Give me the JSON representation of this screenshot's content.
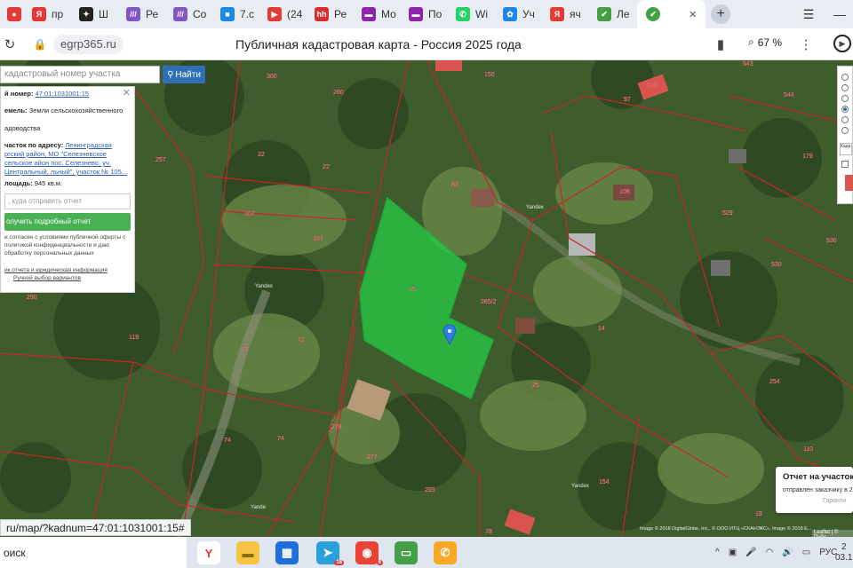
{
  "browser": {
    "tabs": [
      {
        "label": "(24",
        "color": "#e53935",
        "glyph": "●"
      },
      {
        "label": "пр",
        "color": "#e53935",
        "glyph": "Я"
      },
      {
        "label": "Ш",
        "color": "#222222",
        "glyph": "✦"
      },
      {
        "label": "Ре",
        "color": "#7e57c2",
        "glyph": "///"
      },
      {
        "label": "Со",
        "color": "#7e57c2",
        "glyph": "///"
      },
      {
        "label": "7.с",
        "color": "#1e88e5",
        "glyph": "■"
      },
      {
        "label": "(24",
        "color": "#e53935",
        "glyph": "▶"
      },
      {
        "label": "Ре",
        "color": "#d32f2f",
        "glyph": "hh"
      },
      {
        "label": "Мо",
        "color": "#8e24aa",
        "glyph": "▬"
      },
      {
        "label": "По",
        "color": "#8e24aa",
        "glyph": "▬"
      },
      {
        "label": "Wi",
        "color": "#25d366",
        "glyph": "✆"
      },
      {
        "label": "Уч",
        "color": "#1e88e5",
        "glyph": "✿"
      },
      {
        "label": "яч",
        "color": "#e53935",
        "glyph": "Я"
      },
      {
        "label": "Ле",
        "color": "#43a047",
        "glyph": "✔"
      }
    ],
    "active_tab": {
      "label": "",
      "color": "#43a047",
      "glyph": "✔",
      "close": "✕"
    },
    "new_tab": "+",
    "menu_icon": "☰",
    "minimize_icon": "—",
    "domain": "egrp365.ru",
    "page_title": "Публичная кадастровая карта - Россия 2025 года",
    "zoom": "67 %"
  },
  "map": {
    "search_placeholder": "кадастровый номер участка",
    "search_button": "Найти",
    "selected_parcel_label": "15",
    "parcel_numbers": [
      "260",
      "300",
      "150",
      "97",
      "539",
      "543",
      "544",
      "257",
      "22",
      "22",
      "107",
      "107",
      "83",
      "108",
      "529",
      "530",
      "530",
      "72",
      "72",
      "119",
      "74",
      "74",
      "276",
      "277",
      "295",
      "154",
      "78",
      "265/2",
      "14",
      "25",
      "254",
      "290",
      "15",
      "179",
      "110",
      "19"
    ],
    "right_panel": {
      "input_placeholder": "Када"
    },
    "info_panel": {
      "number_label": "й номер:",
      "number_value": "47:01:1031001:15",
      "category_label": "емель:",
      "category_value": "Земли сельскохозяйственного",
      "category_value2": "адоводства",
      "address_label": "часток по адресу:",
      "address_value": "Ленинградская ргский район, МО \"Селезневское сельское айон пос. Селезнево, уч. Центральный, льный\", участок № 105...",
      "area_label": "лощадь:",
      "area_value": "945 кв.м.",
      "email_placeholder": ", куда отправить отчет",
      "report_button": "олучить подробный отчет",
      "consent": "и согласен с условиями публичной оферты с политикой конфиденциальности и даю обработку персональных данных",
      "sample_link": "ик отчета и юридическая информация",
      "manual_link": "Ручной выбор вариантов"
    },
    "toast": {
      "title": "Отчет на участок 53",
      "text": "отправлен заказчику в 2",
      "footer": "Гаранти"
    },
    "attribution": "Image © 2018 DigitalGlobe, Inc., © ООО ИТЦ «СКАНЭКС», Image © 2018 E...",
    "leaflet": "Leaflet | © Публ",
    "status_url": "ru/map/?kadnum=47:01:1031001:15#",
    "street_labels": [
      "Yandex",
      "Yandex",
      "Yandex",
      "Yande"
    ]
  },
  "taskbar": {
    "search": "оиск",
    "apps": [
      {
        "name": "yandex-browser",
        "glyph": "Y",
        "color": "#ffffff",
        "fg": "#e53935"
      },
      {
        "name": "file-explorer",
        "glyph": "▬",
        "color": "#f6c342",
        "fg": "#8a6d0b"
      },
      {
        "name": "calculator-app",
        "glyph": "▦",
        "color": "#1e6fd9",
        "fg": "#ffffff"
      },
      {
        "name": "telegram",
        "glyph": "➤",
        "color": "#2aa0da",
        "fg": "#ffffff",
        "badge": "18"
      },
      {
        "name": "chrome",
        "glyph": "◉",
        "color": "#ea4335",
        "fg": "#ffffff",
        "badge": "6"
      },
      {
        "name": "remote-desktop",
        "glyph": "▭",
        "color": "#43a047",
        "fg": "#ffffff"
      },
      {
        "name": "phone-app",
        "glyph": "✆",
        "color": "#f9a825",
        "fg": "#ffffff"
      }
    ],
    "lang": "РУС",
    "time": "2",
    "date": "03.1"
  }
}
